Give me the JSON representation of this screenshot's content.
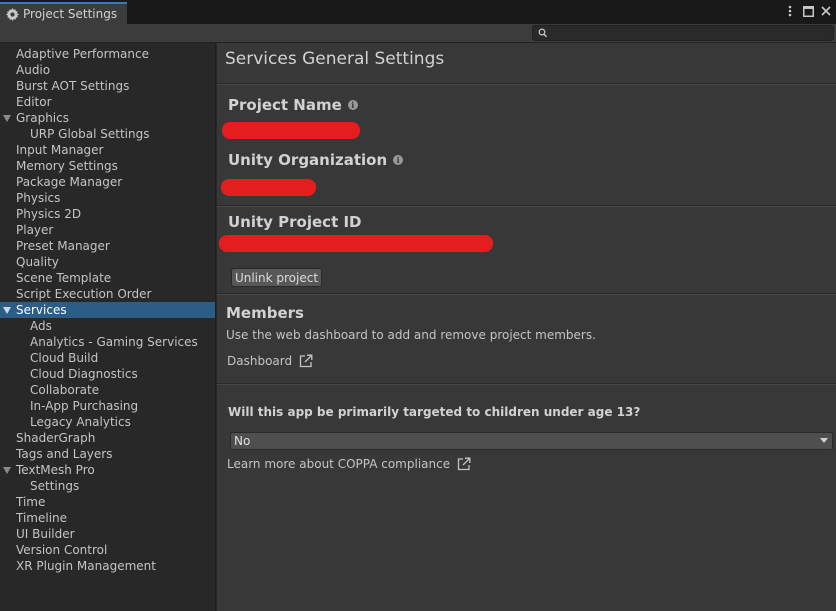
{
  "window": {
    "tab_title": "Project Settings"
  },
  "search": {
    "placeholder": "",
    "value": ""
  },
  "sidebar": {
    "items": [
      {
        "label": "Adaptive Performance",
        "level": 0
      },
      {
        "label": "Audio",
        "level": 0
      },
      {
        "label": "Burst AOT Settings",
        "level": 0
      },
      {
        "label": "Editor",
        "level": 0
      },
      {
        "label": "Graphics",
        "level": 0,
        "expandable": true
      },
      {
        "label": "URP Global Settings",
        "level": 1
      },
      {
        "label": "Input Manager",
        "level": 0
      },
      {
        "label": "Memory Settings",
        "level": 0
      },
      {
        "label": "Package Manager",
        "level": 0
      },
      {
        "label": "Physics",
        "level": 0
      },
      {
        "label": "Physics 2D",
        "level": 0
      },
      {
        "label": "Player",
        "level": 0
      },
      {
        "label": "Preset Manager",
        "level": 0
      },
      {
        "label": "Quality",
        "level": 0
      },
      {
        "label": "Scene Template",
        "level": 0
      },
      {
        "label": "Script Execution Order",
        "level": 0
      },
      {
        "label": "Services",
        "level": 0,
        "expandable": true,
        "selected": true
      },
      {
        "label": "Ads",
        "level": 1
      },
      {
        "label": "Analytics - Gaming Services",
        "level": 1
      },
      {
        "label": "Cloud Build",
        "level": 1
      },
      {
        "label": "Cloud Diagnostics",
        "level": 1
      },
      {
        "label": "Collaborate",
        "level": 1
      },
      {
        "label": "In-App Purchasing",
        "level": 1
      },
      {
        "label": "Legacy Analytics",
        "level": 1
      },
      {
        "label": "ShaderGraph",
        "level": 0
      },
      {
        "label": "Tags and Layers",
        "level": 0
      },
      {
        "label": "TextMesh Pro",
        "level": 0,
        "expandable": true
      },
      {
        "label": "Settings",
        "level": 1
      },
      {
        "label": "Time",
        "level": 0
      },
      {
        "label": "Timeline",
        "level": 0
      },
      {
        "label": "UI Builder",
        "level": 0
      },
      {
        "label": "Version Control",
        "level": 0
      },
      {
        "label": "XR Plugin Management",
        "level": 0
      }
    ]
  },
  "main": {
    "title": "Services General Settings",
    "project_name_label": "Project Name",
    "organization_label": "Unity Organization",
    "project_id_label": "Unity Project ID",
    "unlink_button": "Unlink project",
    "members_title": "Members",
    "members_desc": "Use the web dashboard to add and remove project members.",
    "dashboard_link": "Dashboard",
    "coppa_question": "Will this app be primarily targeted to children under age 13?",
    "coppa_selected": "No",
    "coppa_link": "Learn more about COPPA compliance"
  },
  "colors": {
    "accent": "#2c5d87",
    "redaction": "#e41e1e",
    "panel": "#383838",
    "sidebar": "#282828"
  },
  "icons": {
    "tab": "gear-icon",
    "info": "info-icon",
    "external": "external-link-icon",
    "search": "search-icon"
  }
}
